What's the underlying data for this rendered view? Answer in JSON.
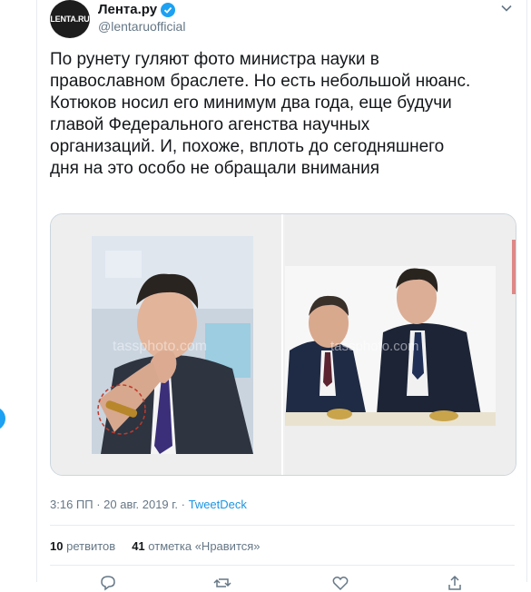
{
  "account": {
    "avatar_text": "LENTA.RU",
    "name": "Лента.ру",
    "handle": "@lentaruofficial"
  },
  "tweet": {
    "text": "По рунету гуляют фото министра науки в\nправославном браслете. Но есть небольшой нюанс.\nКотюков носил его минимум два года, еще будучи\nглавой Федерального агенства научных\nорганизаций. И, похоже, вплоть до сегодняшнего\nдня на это особо не обращали внимания"
  },
  "media": {
    "watermark_left": "tassphoto.com",
    "watermark_right": "tassphoto.com"
  },
  "meta": {
    "time_date": "3:16 ПП · 20 авг. 2019 г. · ",
    "source": "TweetDeck"
  },
  "stats": {
    "retweets_count": "10",
    "retweets_label": "ретвитов",
    "likes_count": "41",
    "likes_label": "отметка «Нравится»"
  },
  "colors": {
    "accent": "#1da1f2",
    "link": "#1b95e0",
    "muted": "#657786",
    "text": "#14171a"
  }
}
